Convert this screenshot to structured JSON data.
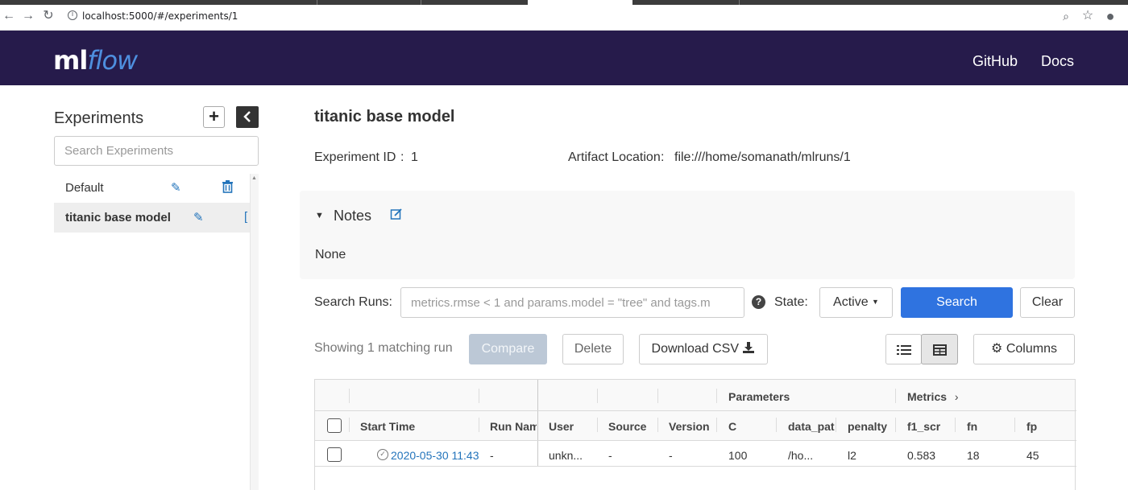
{
  "browser": {
    "url": "localhost:5000/#/experiments/1",
    "back_icon": "arrow-left",
    "forward_icon": "arrow-right",
    "reload_icon": "reload",
    "zoom_icon": "magnifier",
    "star_icon": "star",
    "account_icon": "account-circle"
  },
  "header": {
    "logo_ml": "ml",
    "logo_flow": "flow",
    "links": [
      "GitHub",
      "Docs"
    ]
  },
  "sidebar": {
    "title": "Experiments",
    "search_placeholder": "Search Experiments",
    "items": [
      {
        "name": "Default",
        "active": false
      },
      {
        "name": "titanic base model",
        "active": true
      }
    ]
  },
  "experiment": {
    "title": "titanic base model",
    "id_label": "Experiment ID",
    "id_value": "1",
    "artifact_label": "Artifact Location",
    "artifact_value": "file:///home/somanath/mlruns/1"
  },
  "notes": {
    "title": "Notes",
    "body": "None"
  },
  "search": {
    "label": "Search Runs:",
    "placeholder": "metrics.rmse < 1 and params.model = \"tree\" and tags.m",
    "state_label": "State:",
    "state_value": "Active",
    "search_button": "Search",
    "clear_button": "Clear"
  },
  "toolbar": {
    "showing_text": "Showing 1 matching run",
    "compare": "Compare",
    "delete": "Delete",
    "download_csv": "Download CSV",
    "columns": "Columns"
  },
  "table": {
    "group_headers": {
      "parameters": "Parameters",
      "metrics": "Metrics"
    },
    "columns": [
      "Start Time",
      "Run Nam",
      "User",
      "Source",
      "Version",
      "C",
      "data_pat",
      "penalty",
      "f1_scr",
      "fn",
      "fp"
    ],
    "rows": [
      {
        "start_time": "2020-05-30 11:43",
        "run_name": "-",
        "user": "unkn...",
        "source": "-",
        "version": "-",
        "C": "100",
        "data_path": "/ho...",
        "penalty": "l2",
        "f1_scr": "0.583",
        "fn": "18",
        "fp": "45"
      }
    ]
  },
  "colors": {
    "header_bg": "#261b4b",
    "logo_flow": "#4e8fdf",
    "link_blue": "#2374bb",
    "primary_button": "#2f73e0"
  }
}
